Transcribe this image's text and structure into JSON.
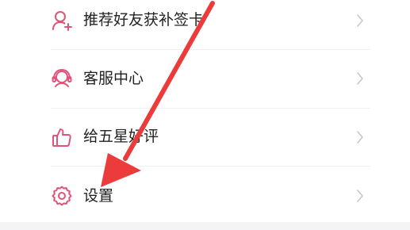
{
  "menu": {
    "items": [
      {
        "label": "推荐好友获补签卡",
        "icon": "add-user-icon"
      },
      {
        "label": "客服中心",
        "icon": "customer-service-icon"
      },
      {
        "label": "给五星好评",
        "icon": "thumbs-up-icon"
      },
      {
        "label": "设置",
        "icon": "gear-icon"
      }
    ]
  },
  "colors": {
    "icon_accent": "#e0547a",
    "arrow": "#ec3b3b",
    "chevron": "#c8c8c8",
    "text": "#222222"
  }
}
